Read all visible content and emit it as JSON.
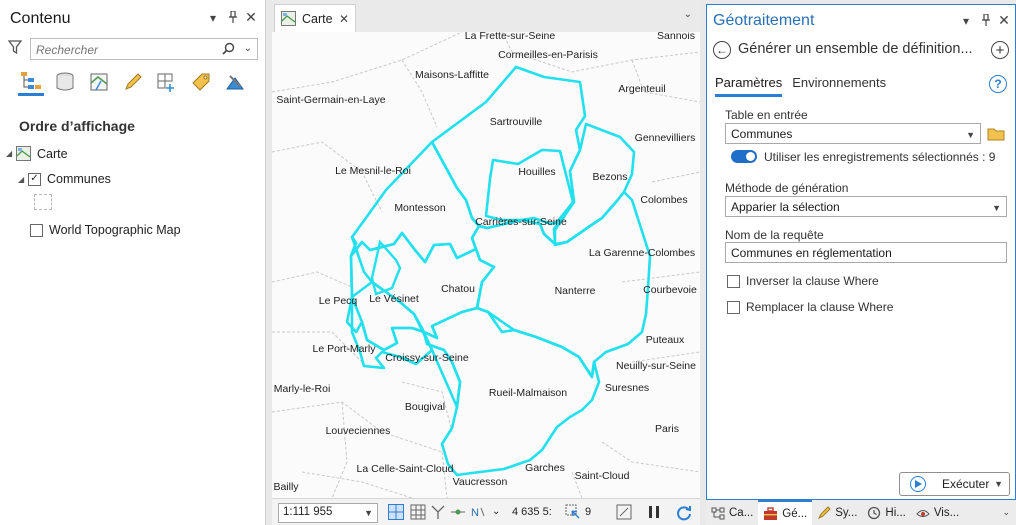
{
  "contents": {
    "title": "Contenu",
    "search_placeholder": "Rechercher",
    "order_title": "Ordre d’affichage",
    "layers": {
      "map_name": "Carte",
      "communes": "Communes",
      "basemap": "World Topographic Map"
    },
    "toolbar_icons": [
      "list-by-drawing-order-icon",
      "list-by-data-source-icon",
      "list-by-selection-icon",
      "list-by-editing-icon",
      "list-by-snapping-icon",
      "list-by-labeling-icon",
      "list-by-perspective-icon"
    ]
  },
  "map": {
    "tab_label": "Carte",
    "feature_color": "#22e0ee",
    "places": [
      {
        "name": "La Frette-sur-Seine"
      },
      {
        "name": "Sannois"
      },
      {
        "name": "Cormeilles-en-Parisis"
      },
      {
        "name": "Maisons-Laffitte"
      },
      {
        "name": "Argenteuil"
      },
      {
        "name": "Saint-Germain-en-Laye"
      },
      {
        "name": "Sartrouville"
      },
      {
        "name": "Gennevilliers"
      },
      {
        "name": "Le Mesnil-le-Roi"
      },
      {
        "name": "Houilles"
      },
      {
        "name": "Bezons"
      },
      {
        "name": "Colombes"
      },
      {
        "name": "Montesson"
      },
      {
        "name": "Carrières-sur-Seine"
      },
      {
        "name": "La Garenne-Colombes"
      },
      {
        "name": "Chatou"
      },
      {
        "name": "Nanterre"
      },
      {
        "name": "Courbevoie"
      },
      {
        "name": "Le Vésinet"
      },
      {
        "name": "Le Pecq"
      },
      {
        "name": "Puteaux"
      },
      {
        "name": "Le Port-Marly"
      },
      {
        "name": "Croissy-sur-Seine"
      },
      {
        "name": "Neuilly-sur-Seine"
      },
      {
        "name": "Suresnes"
      },
      {
        "name": "Marly-le-Roi"
      },
      {
        "name": "Rueil-Malmaison"
      },
      {
        "name": "Bougival"
      },
      {
        "name": "Louveciennes"
      },
      {
        "name": "Paris"
      },
      {
        "name": "La Celle-Saint-Cloud"
      },
      {
        "name": "Garches"
      },
      {
        "name": "Saint-Cloud"
      },
      {
        "name": "Vaucresson"
      },
      {
        "name": "Bailly"
      }
    ],
    "status": {
      "scale": "1:111 955",
      "coordinates": "4 635 5:",
      "selected_count": "9"
    }
  },
  "geoprocessing": {
    "title": "Géotraitement",
    "tool_name": "Générer un ensemble de définition...",
    "tabs": [
      "Paramètres",
      "Environnements"
    ],
    "input_table_label": "Table en entrée",
    "input_table_value": "Communes",
    "use_selected_label": "Utiliser les enregistrements sélectionnés : 9",
    "generation_method_label": "Méthode de génération",
    "generation_method_value": "Apparier la sélection",
    "query_name_label": "Nom de la requête",
    "query_name_value": "Communes en réglementation",
    "invert_where_label": "Inverser la clause Where",
    "replace_where_label": "Remplacer la clause Where",
    "run_label": "Exécuter"
  },
  "bottom_tabs": [
    {
      "label": "Ca...",
      "icon": "catalog-icon"
    },
    {
      "label": "Gé...",
      "icon": "geoprocessing-toolbox-icon"
    },
    {
      "label": "Sy...",
      "icon": "symbology-icon"
    },
    {
      "label": "Hi...",
      "icon": "history-icon"
    },
    {
      "label": "Vis...",
      "icon": "visibility-range-icon"
    }
  ]
}
